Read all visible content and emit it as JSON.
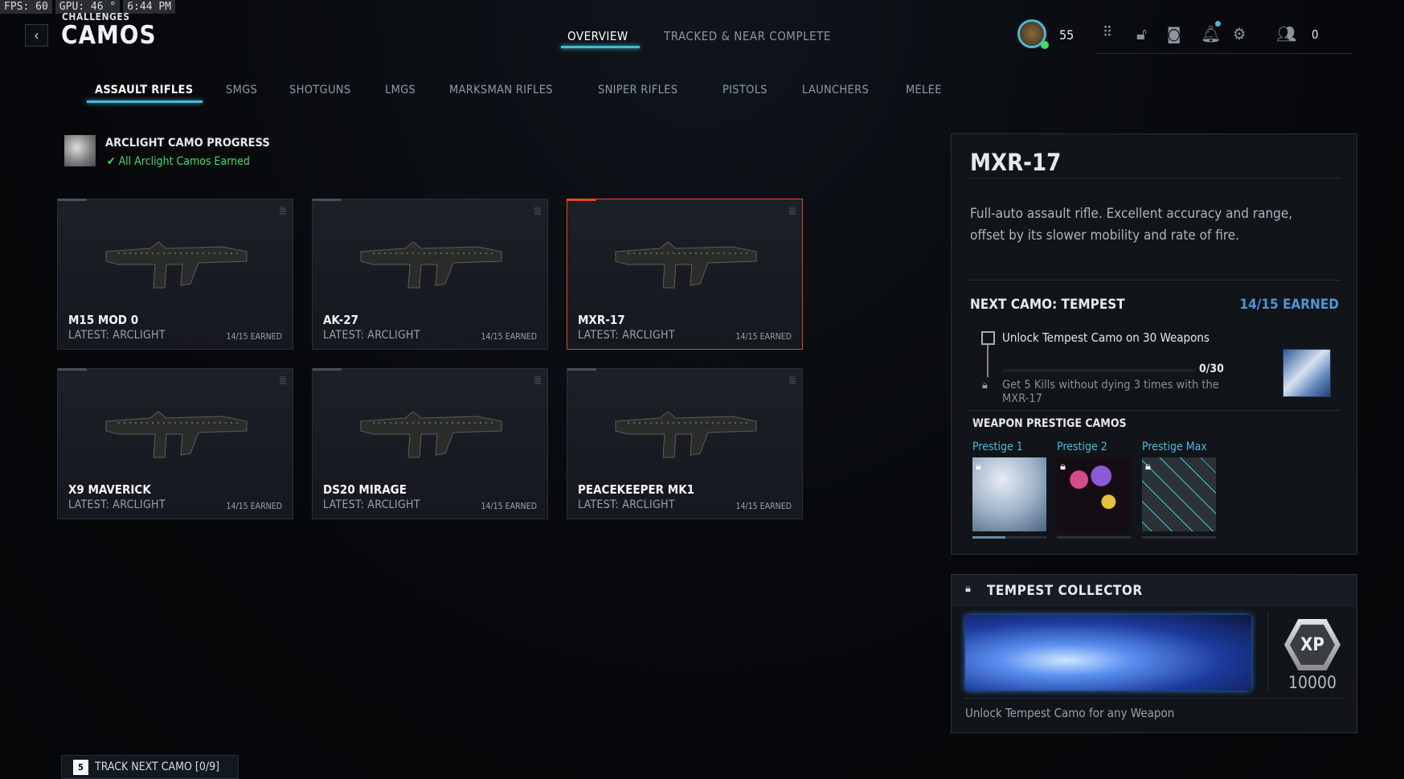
{
  "hud": {
    "fps": "FPS:  60",
    "gpu": "GPU: 46 °",
    "time": "6:44 PM"
  },
  "header": {
    "breadcrumb": "CHALLENGES",
    "title": "CAMOS",
    "back": "‹"
  },
  "top_tabs": [
    {
      "label": "OVERVIEW",
      "active": true
    },
    {
      "label": "TRACKED & NEAR COMPLETE",
      "active": false
    }
  ],
  "profile": {
    "level": "55",
    "currency": "0"
  },
  "categories": [
    "ASSAULT RIFLES",
    "SMGS",
    "SHOTGUNS",
    "LMGS",
    "MARKSMAN RIFLES",
    "SNIPER RIFLES",
    "PISTOLS",
    "LAUNCHERS",
    "MELEE"
  ],
  "arclight": {
    "title": "ARCLIGHT CAMO PROGRESS",
    "status": "All Arclight Camos Earned",
    "check": "✔"
  },
  "weapons": [
    {
      "name": "M15 MOD 0",
      "latest": "LATEST: ARCLIGHT",
      "earned": "14/15 EARNED"
    },
    {
      "name": "AK-27",
      "latest": "LATEST: ARCLIGHT",
      "earned": "14/15 EARNED"
    },
    {
      "name": "MXR-17",
      "latest": "LATEST: ARCLIGHT",
      "earned": "14/15 EARNED"
    },
    {
      "name": "X9 MAVERICK",
      "latest": "LATEST: ARCLIGHT",
      "earned": "14/15 EARNED"
    },
    {
      "name": "DS20 MIRAGE",
      "latest": "LATEST: ARCLIGHT",
      "earned": "14/15 EARNED"
    },
    {
      "name": "PEACEKEEPER MK1",
      "latest": "LATEST: ARCLIGHT",
      "earned": "14/15 EARNED"
    }
  ],
  "detail": {
    "weapon": "MXR-17",
    "description": "Full-auto assault rifle. Excellent accuracy and range, offset by its slower mobility and rate of fire.",
    "next_camo": "NEXT CAMO: TEMPEST",
    "earned": "14/15 EARNED",
    "challenge": "Unlock Tempest Camo on 30 Weapons",
    "progress": "0/30",
    "progress_fraction": 0,
    "sub_challenge": "Get 5 Kills without dying 3 times with the MXR-17",
    "prestige_title": "WEAPON PRESTIGE CAMOS",
    "prestige": [
      "Prestige 1",
      "Prestige 2",
      "Prestige Max"
    ]
  },
  "collector": {
    "title": "TEMPEST COLLECTOR",
    "xp_label": "XP",
    "xp": "10000",
    "description": "Unlock Tempest Camo for any Weapon"
  },
  "track": {
    "key": "5",
    "label": "TRACK NEXT CAMO [0/9]"
  },
  "colors": {
    "accent": "#48b9d8",
    "selected": "#e0491e",
    "success": "#3ddc6a",
    "earned": "#4f95d6"
  }
}
